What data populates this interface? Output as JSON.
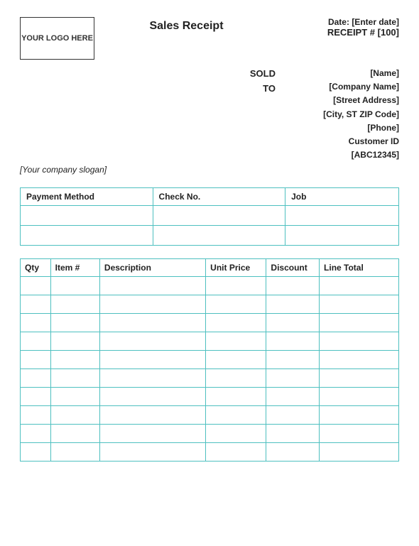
{
  "page": {
    "title": "Sales Receipt"
  },
  "header": {
    "logo_text": "YOUR LOGO\nHERE",
    "date_label": "Date:",
    "date_value": "[Enter date]",
    "receipt_label": "RECEIPT #",
    "receipt_value": "[100]"
  },
  "sold_to": {
    "label_line1": "SOLD",
    "label_line2": "TO",
    "name": "[Name]",
    "company": "[Company Name]",
    "address": "[Street Address]",
    "city": "[City, ST  ZIP Code]",
    "phone": "[Phone]",
    "customer_id_label": "Customer ID",
    "customer_id_value": "[ABC12345]"
  },
  "slogan": "[Your company slogan]",
  "payment_table": {
    "headers": [
      "Payment Method",
      "Check No.",
      "Job"
    ],
    "rows": [
      [
        "",
        "",
        ""
      ],
      [
        "",
        "",
        ""
      ]
    ]
  },
  "items_table": {
    "headers": [
      "Qty",
      "Item #",
      "Description",
      "Unit Price",
      "Discount",
      "Line Total"
    ],
    "rows": 10
  }
}
